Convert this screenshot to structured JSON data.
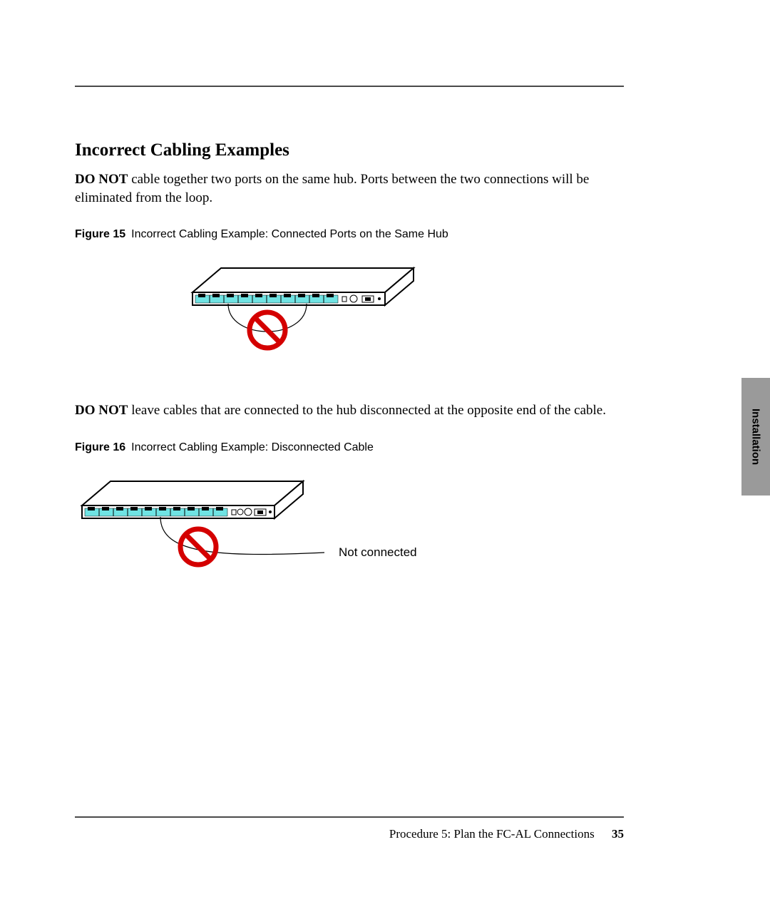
{
  "heading": "Incorrect Cabling Examples",
  "para1": {
    "lead_bold": "DO NOT",
    "rest": " cable together two ports on the same hub. Ports between the two connections will be eliminated from the loop."
  },
  "fig15": {
    "label": "Figure 15",
    "caption": "Incorrect Cabling Example: Connected Ports on the Same Hub"
  },
  "para2": {
    "lead_bold": "DO NOT",
    "rest": " leave cables that are connected to the hub disconnected at the opposite end of the cable."
  },
  "fig16": {
    "label": "Figure 16",
    "caption": "Incorrect Cabling Example: Disconnected Cable",
    "annotation": "Not connected"
  },
  "side_tab": "Installation",
  "footer": {
    "text": "Procedure 5: Plan the FC-AL Connections",
    "page": "35"
  }
}
